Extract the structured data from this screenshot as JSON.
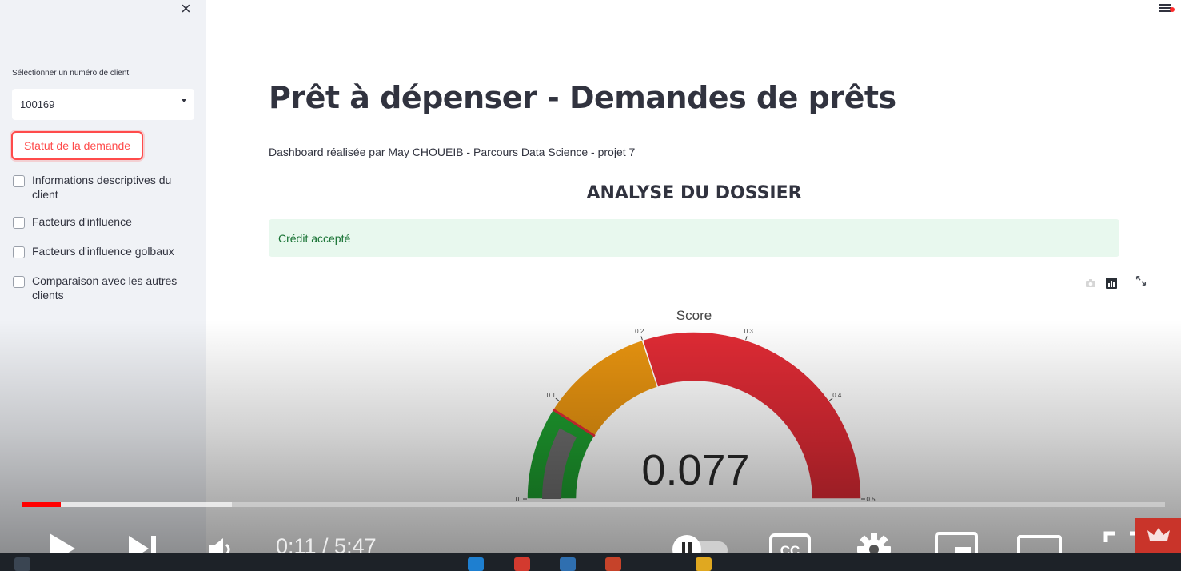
{
  "sidebar": {
    "close_label": "×",
    "select_label": "Sélectionner un numéro de client",
    "select_value": "100169",
    "status_button": "Statut de la demande",
    "checkboxes": [
      {
        "label": "Informations descriptives du client",
        "checked": false
      },
      {
        "label": "Facteurs d'influence",
        "checked": false
      },
      {
        "label": "Facteurs d'influence golbaux",
        "checked": false
      },
      {
        "label": "Comparaison avec les autres clients",
        "checked": false
      }
    ]
  },
  "main": {
    "title": "Prêt à dépenser - Demandes de prêts",
    "subtitle": "Dashboard réalisée par May CHOUEIB - Parcours Data Science - projet 7",
    "section_heading": "ANALYSE DU DOSSIER",
    "alert_text": "Crédit accepté",
    "modebar_icons": [
      "camera-icon",
      "bar-chart-icon",
      "expand-icon"
    ]
  },
  "chart_data": {
    "type": "gauge",
    "title": "Score",
    "value": 0.077,
    "value_label": "0.077",
    "range": [
      0,
      0.5
    ],
    "ticks": [
      0,
      0.1,
      0.2,
      0.3,
      0.4,
      0.5
    ],
    "tick_labels": [
      "0",
      "0.1",
      "0.2",
      "0.3",
      "0.4",
      "0.5"
    ],
    "steps": [
      {
        "range": [
          0,
          0.09
        ],
        "color": "#1e9e2f"
      },
      {
        "range": [
          0.09,
          0.2
        ],
        "color": "#e89410"
      },
      {
        "range": [
          0.2,
          0.5
        ],
        "color": "#e02b35"
      }
    ],
    "threshold": 0.09,
    "threshold_color": "#e02b35"
  },
  "video_player": {
    "current_time": "0:11",
    "duration": "5:47",
    "time_display": "0:11 / 5:47",
    "played_fraction": 0.034,
    "buffered_fraction": 0.184,
    "colors": {
      "played": "#ff0000",
      "badge": "#c9342a"
    }
  }
}
